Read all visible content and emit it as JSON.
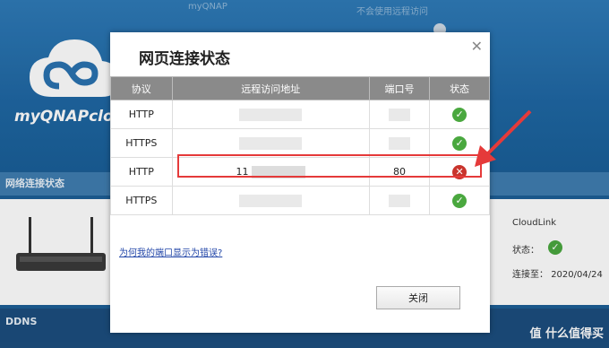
{
  "background": {
    "logo_text": "myQNAPcloud",
    "faint_text_1": "myQNAP",
    "faint_text_2": "不会使用远程访问",
    "section_network": "网络连接状态",
    "section_ddns": "DDNS",
    "cloudlink": {
      "title": "CloudLink",
      "status_label": "状态：",
      "connected_label": "连接至：",
      "connected_value": "2020/04/24"
    },
    "watermark": "值 什么值得买"
  },
  "dialog": {
    "title": "网页连接状态",
    "columns": [
      "协议",
      "远程访问地址",
      "端口号",
      "状态"
    ],
    "rows": [
      {
        "protocol": "HTTP",
        "address": "",
        "port": "",
        "status": "ok"
      },
      {
        "protocol": "HTTPS",
        "address": "",
        "port": "",
        "status": "ok"
      },
      {
        "protocol": "HTTP",
        "address": "11",
        "port": "80",
        "status": "error"
      },
      {
        "protocol": "HTTPS",
        "address": "",
        "port": "",
        "status": "ok"
      }
    ],
    "help_link": "为何我的端口显示为错误?",
    "close_button": "关闭"
  },
  "colors": {
    "ok": "#4aa83f",
    "error": "#c9342c",
    "annotation": "#e53a3a"
  }
}
